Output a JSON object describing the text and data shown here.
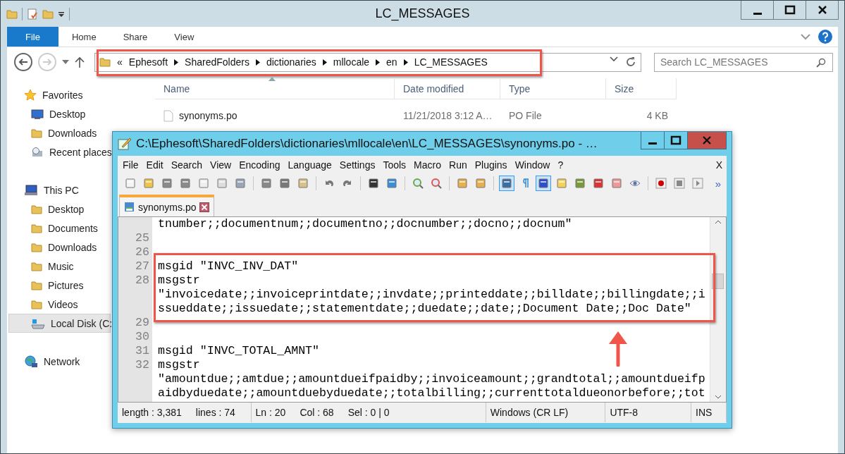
{
  "explorer": {
    "title": "LC_MESSAGES",
    "ribbon_tabs": [
      {
        "label": "File",
        "selected": true
      },
      {
        "label": "Home",
        "selected": false
      },
      {
        "label": "Share",
        "selected": false
      },
      {
        "label": "View",
        "selected": false
      }
    ],
    "forward": {
      "disabled": true
    },
    "address": {
      "overflow": "«",
      "crumbs": [
        "Ephesoft",
        "SharedFolders",
        "dictionaries",
        "mllocale",
        "en",
        "LC_MESSAGES"
      ]
    },
    "search": {
      "placeholder": "Search LC_MESSAGES"
    },
    "sidebar": [
      {
        "label": "Favorites",
        "selected": false,
        "children": [
          {
            "label": "Desktop",
            "selected": false
          },
          {
            "label": "Downloads",
            "selected": false
          },
          {
            "label": "Recent places",
            "selected": false
          }
        ]
      },
      {
        "label": "This PC",
        "selected": false,
        "children": [
          {
            "label": "Desktop",
            "selected": false
          },
          {
            "label": "Documents",
            "selected": false
          },
          {
            "label": "Downloads",
            "selected": false
          },
          {
            "label": "Music",
            "selected": false
          },
          {
            "label": "Pictures",
            "selected": false
          },
          {
            "label": "Videos",
            "selected": false
          },
          {
            "label": "Local Disk (C:",
            "selected": true
          }
        ]
      },
      {
        "label": "Network",
        "selected": false
      }
    ],
    "file_list": {
      "columns": [
        "Name",
        "Date modified",
        "Type",
        "Size"
      ],
      "rows": [
        {
          "cells": [
            "synonyms.po",
            "11/21/2018 3:12 A…",
            "PO File",
            "4 KB"
          ],
          "selected": false
        }
      ]
    }
  },
  "editor_window": {
    "title": "C:\\Ephesoft\\SharedFolders\\dictionaries\\mllocale\\en\\LC_MESSAGES\\synonyms.po - …",
    "menu": [
      "File",
      "Edit",
      "Search",
      "View",
      "Encoding",
      "Language",
      "Settings",
      "Tools",
      "Macro",
      "Run",
      "Plugins",
      "Window",
      "?"
    ],
    "menu_close": "X",
    "toolbar": [
      {
        "pressed": false
      },
      {
        "pressed": false
      },
      {
        "pressed": false
      },
      {
        "pressed": false
      },
      {
        "pressed": false
      },
      {
        "pressed": false
      },
      {
        "pressed": false
      },
      {
        "pressed": false
      },
      {
        "pressed": false
      },
      {
        "pressed": false
      },
      {
        "pressed": false
      },
      {
        "pressed": false
      },
      {
        "pressed": false
      },
      {
        "pressed": false
      },
      {
        "pressed": false
      },
      {
        "pressed": false
      },
      {
        "pressed": false
      },
      {
        "pressed": false
      },
      {
        "pressed": true
      },
      {
        "pressed": false
      },
      {
        "pressed": true
      },
      {
        "pressed": false
      },
      {
        "pressed": false
      },
      {
        "pressed": false
      },
      {
        "pressed": false
      },
      {
        "pressed": false
      },
      {
        "pressed": false
      },
      {
        "pressed": false
      },
      {
        "pressed": false
      }
    ],
    "toolbar_more": "»",
    "tabs": [
      {
        "label": "synonyms.po",
        "selected": true
      }
    ],
    "lines": [
      {
        "text": "tnumber;;documentnum;;documentno;;docnumber;;docno;;docnum\""
      },
      {
        "number": "25"
      },
      {
        "number": "26"
      },
      {
        "number": "27",
        "text": "msgid \"INVC_INV_DAT\""
      },
      {
        "number": "28",
        "text": "msgstr"
      },
      {
        "text": "\"invoicedate;;invoiceprintdate;;invdate;;printeddate;;billdate;;billingdate;;i"
      },
      {
        "text": "ssueddate;;issuedate;;statementdate;;duedate;;date;;Document Date;;Doc Date\""
      },
      {
        "number": "29"
      },
      {
        "number": "30"
      },
      {
        "number": "31",
        "text": "msgid \"INVC_TOTAL_AMNT\""
      },
      {
        "number": "32",
        "text": "msgstr"
      },
      {
        "text": "\"amountdue;;amtdue;;amountdueifpaidby;;invoiceamount;;grandtotal;;amountdueifp"
      },
      {
        "text": "aidbyduedate;;amountduebyduedate;;totalbilling;;currenttotaldueonorbefore;;tot"
      }
    ],
    "status_bar": [
      {
        "items": [
          "length : 3,381",
          "lines : 74"
        ]
      },
      {
        "items": [
          "Ln : 20",
          "Col : 68",
          "Sel : 0 | 0"
        ]
      },
      {
        "items": [
          "Windows (CR LF)"
        ]
      },
      {
        "items": [
          "UTF-8"
        ]
      },
      {
        "items": [
          "INS"
        ]
      }
    ]
  }
}
